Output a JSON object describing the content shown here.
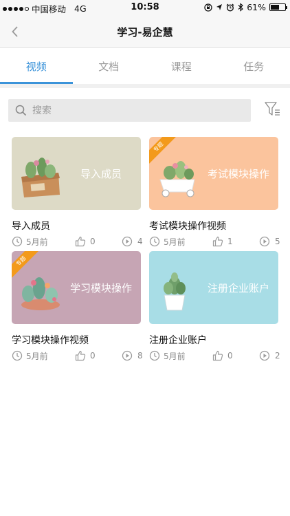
{
  "status_bar": {
    "carrier": "中国移动",
    "network": "4G",
    "time": "10:58",
    "battery": "61%",
    "battery_level": 0.61
  },
  "header": {
    "title": "学习-易企慧"
  },
  "tabs": [
    {
      "label": "视频",
      "active": true
    },
    {
      "label": "文档",
      "active": false
    },
    {
      "label": "课程",
      "active": false
    },
    {
      "label": "任务",
      "active": false
    }
  ],
  "search": {
    "placeholder": "搜索"
  },
  "cards": [
    {
      "thumb_label": "导入成员",
      "title": "导入成员",
      "time": "5月前",
      "likes": "0",
      "plays": "4",
      "badge": "",
      "bg": "#dddac6"
    },
    {
      "thumb_label": "考试模块操作",
      "title": "考试模块操作视频",
      "time": "5月前",
      "likes": "1",
      "plays": "5",
      "badge": "专题",
      "bg": "#fbc49d"
    },
    {
      "thumb_label": "学习模块操作",
      "title": "学习模块操作视频",
      "time": "5月前",
      "likes": "0",
      "plays": "8",
      "badge": "专题",
      "bg": "#c6a5b4"
    },
    {
      "thumb_label": "注册企业账户",
      "title": "注册企业账户",
      "time": "5月前",
      "likes": "0",
      "plays": "2",
      "badge": "",
      "bg": "#a8dde6"
    }
  ],
  "colors": {
    "accent": "#3b93d9",
    "badge": "#f39a1b"
  }
}
